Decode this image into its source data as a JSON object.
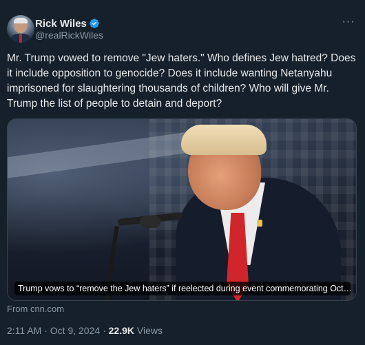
{
  "author": {
    "display_name": "Rick Wiles",
    "handle": "@realRickWiles",
    "verified": true
  },
  "tweet": {
    "text": "Mr. Trump vowed to remove \"Jew haters.\" Who defines Jew hatred? Does it include opposition to genocide? Does it include wanting Netanyahu imprisoned for slaughtering thousands of children? Who will give Mr. Trump the list of people to detain and deport?"
  },
  "card": {
    "caption": "Trump vows to “remove the Jew haters” if reelected during event commemorating Oct…",
    "source": "From cnn.com"
  },
  "meta": {
    "time": "2:11 AM",
    "separator": "·",
    "date": "Oct 9, 2024",
    "views_count": "22.9K",
    "views_label": "Views"
  },
  "icons": {
    "verified": "verified-badge-icon",
    "more": "more-options-icon"
  },
  "colors": {
    "background": "#15202b",
    "text_primary": "#e7e9ea",
    "text_secondary": "#8b98a5",
    "verified_blue": "#1d9bf0",
    "border": "#38444d"
  }
}
